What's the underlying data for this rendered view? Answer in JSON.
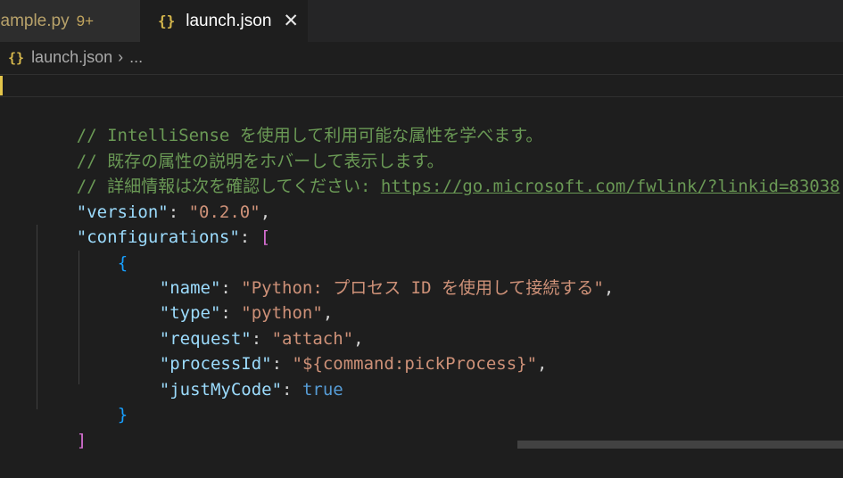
{
  "tabs": [
    {
      "label": "sample.py",
      "badge": "9+",
      "active": false
    },
    {
      "label": "launch.json",
      "icon": "{}",
      "close": "✕",
      "active": true
    }
  ],
  "breadcrumb": {
    "icon": "{}",
    "file": "launch.json",
    "separator": "›",
    "more": "..."
  },
  "editor": {
    "comment1": "// IntelliSense を使用して利用可能な属性を学べます。",
    "comment2": "// 既存の属性の説明をホバーして表示します。",
    "comment3_prefix": "// 詳細情報は次を確認してください: ",
    "comment3_link": "https://go.microsoft.com/fwlink/?linkid=83038",
    "version_key": "\"version\"",
    "version_value": "\"0.2.0\"",
    "configurations_key": "\"configurations\"",
    "open_bracket": "[",
    "open_brace": "{",
    "close_brace": "}",
    "close_bracket": "]",
    "fields": [
      {
        "key": "\"name\"",
        "value": "\"Python: プロセス ID を使用して接続する\"",
        "type": "string",
        "comma": ","
      },
      {
        "key": "\"type\"",
        "value": "\"python\"",
        "type": "string",
        "comma": ","
      },
      {
        "key": "\"request\"",
        "value": "\"attach\"",
        "type": "string",
        "comma": ","
      },
      {
        "key": "\"processId\"",
        "value": "\"${command:pickProcess}\"",
        "type": "string",
        "comma": ","
      },
      {
        "key": "\"justMyCode\"",
        "value": "true",
        "type": "bool",
        "comma": ""
      }
    ]
  },
  "colors": {
    "background": "#1e1e1e",
    "comment": "#6a9955",
    "key": "#9cdcfe",
    "string": "#ce9178",
    "keyword": "#569cd6",
    "bracket_level1": "#da70d6",
    "bracket_level2": "#179fff",
    "json_icon": "#d4b64c"
  }
}
